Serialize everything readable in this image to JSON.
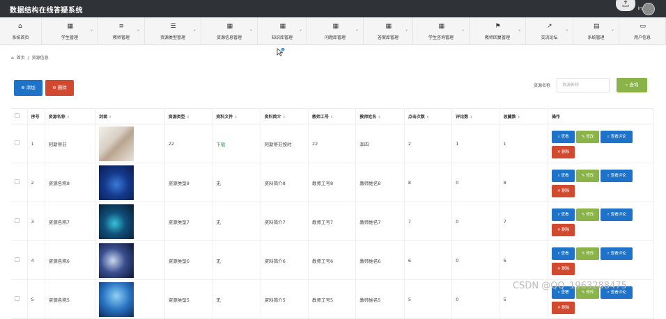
{
  "app": {
    "title": "数据结构在线答疑系统",
    "user": "in"
  },
  "nav": [
    {
      "icon": "home-icon",
      "label": "系统首页",
      "glyph": "⌂"
    },
    {
      "icon": "grid-icon",
      "label": "学生管理",
      "glyph": "▦"
    },
    {
      "icon": "list-icon",
      "label": "教师管理",
      "glyph": "≡"
    },
    {
      "icon": "list-icon",
      "label": "资源类型管理",
      "glyph": "☰"
    },
    {
      "icon": "grid-icon",
      "label": "资源信息管理",
      "glyph": "▦"
    },
    {
      "icon": "grid-icon",
      "label": "知识库管理",
      "glyph": "▦"
    },
    {
      "icon": "grid-icon",
      "label": "问题库管理",
      "glyph": "▦"
    },
    {
      "icon": "grid-icon",
      "label": "答案库管理",
      "glyph": "▦"
    },
    {
      "icon": "grid-icon",
      "label": "学生咨询管理",
      "glyph": "▦"
    },
    {
      "icon": "flag-icon",
      "label": "教师回复管理",
      "glyph": "⚑"
    },
    {
      "icon": "chart-icon",
      "label": "交流论坛",
      "glyph": "↗"
    },
    {
      "icon": "clipboard-icon",
      "label": "系统管理",
      "glyph": "▤"
    },
    {
      "icon": "card-icon",
      "label": "用户信息",
      "glyph": "▭"
    }
  ],
  "breadcrumb": {
    "home": "首页",
    "sep": "/",
    "current": "资源信息"
  },
  "toolbar": {
    "add": "添加",
    "delete": "删除"
  },
  "search": {
    "label": "资源名称",
    "placeholder": "资源名称",
    "button": "查询"
  },
  "table": {
    "headers": [
      "序号",
      "资源名称",
      "封面",
      "资源类型",
      "资料文件",
      "资料简介",
      "教师工号",
      "教师姓名",
      "点击次数",
      "评论数",
      "收藏数",
      "操作"
    ],
    "rows": [
      {
        "no": "1",
        "name": "阿斯蒂芬",
        "type": "22",
        "file": "下载",
        "intro": "阿斯蒂芬按时",
        "tid": "22",
        "tname": "李四",
        "clicks": "2",
        "comments": "1",
        "favs": "1"
      },
      {
        "no": "2",
        "name": "资源名称8",
        "type": "资源类型8",
        "file": "无",
        "intro": "资料简介8",
        "tid": "教师工号8",
        "tname": "教师姓名8",
        "clicks": "8",
        "comments": "0",
        "favs": "8"
      },
      {
        "no": "3",
        "name": "资源名称7",
        "type": "资源类型7",
        "file": "无",
        "intro": "资料简介7",
        "tid": "教师工号7",
        "tname": "教师姓名7",
        "clicks": "7",
        "comments": "0",
        "favs": "7"
      },
      {
        "no": "4",
        "name": "资源名称6",
        "type": "资源类型6",
        "file": "无",
        "intro": "资料简介6",
        "tid": "教师工号6",
        "tname": "教师姓名6",
        "clicks": "6",
        "comments": "0",
        "favs": "6"
      },
      {
        "no": "5",
        "name": "资源名称5",
        "type": "资源类型5",
        "file": "无",
        "intro": "资料简介5",
        "tid": "教师工号5",
        "tname": "教师姓名5",
        "clicks": "5",
        "comments": "0",
        "favs": "5"
      }
    ],
    "actions": {
      "view": "查看",
      "edit": "修改",
      "comments": "查看评论",
      "delete": "删除"
    }
  },
  "watermark": "CSDN @QQ_1963288475",
  "colors": {
    "topbar": "#2f3337",
    "primary": "#1e72c8",
    "success": "#8ab34a",
    "danger": "#d14a30",
    "link": "#1e9e4a"
  }
}
